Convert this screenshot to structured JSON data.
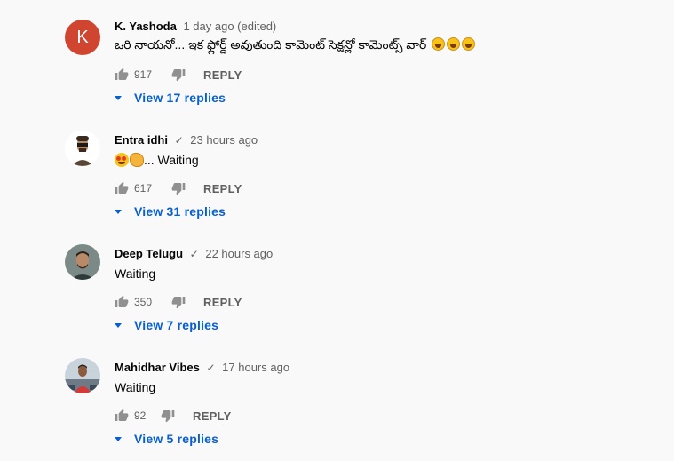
{
  "comments": [
    {
      "author": "K. Yashoda",
      "verified": false,
      "time": "1 day ago (edited)",
      "avatar_letter": "K",
      "text": "ఒరి నాయనో... ఇక ఫ్లోర్డ్ అవుతుంది కామెంట్ సెక్షన్లో కామెంట్స్ వార్",
      "likes": "917",
      "reply_label": "REPLY",
      "view_replies": "View 17 replies"
    },
    {
      "author": "Entra idhi",
      "verified": true,
      "time": "23 hours ago",
      "text": "... Waiting",
      "likes": "617",
      "reply_label": "REPLY",
      "view_replies": "View 31 replies"
    },
    {
      "author": "Deep Telugu",
      "verified": true,
      "time": "22 hours ago",
      "text": "Waiting",
      "likes": "350",
      "reply_label": "REPLY",
      "view_replies": "View 7 replies"
    },
    {
      "author": "Mahidhar Vibes",
      "verified": true,
      "time": "17 hours ago",
      "text": "Waiting",
      "likes": "92",
      "reply_label": "REPLY",
      "view_replies": "View 5 replies"
    }
  ],
  "icons": {
    "like": "thumbs-up-icon",
    "dislike": "thumbs-down-icon",
    "verified": "check-icon",
    "expand": "caret-down-icon"
  },
  "colors": {
    "link": "#065fd4",
    "meta": "#606060",
    "avatar_k": "#d0452f"
  }
}
